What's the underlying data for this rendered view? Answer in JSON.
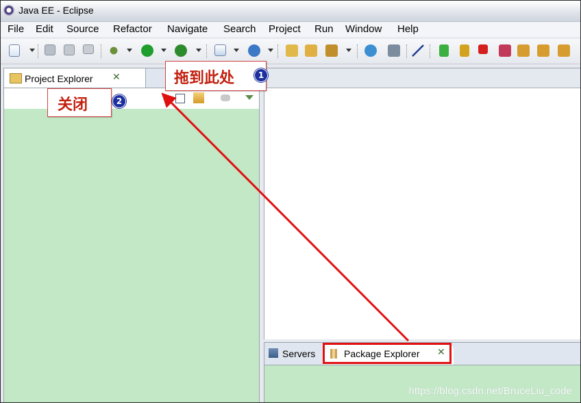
{
  "window": {
    "title": "Java EE - Eclipse"
  },
  "menu": [
    "File",
    "Edit",
    "Source",
    "Refactor",
    "Navigate",
    "Search",
    "Project",
    "Run",
    "Window",
    "Help"
  ],
  "left_view": {
    "tab_label": "Project Explorer"
  },
  "bottom_view": {
    "tabs": [
      "Servers",
      "Package Explorer"
    ]
  },
  "annotations": {
    "callout_drag": "拖到此处",
    "callout_close": "关闭",
    "badge1": "1",
    "badge2": "2"
  },
  "watermark": "https://blog.csdn.net/BruceLiu_code",
  "colors": {
    "view_background": "#c2e8c6",
    "highlight": "#e01010",
    "badge": "#1c2f9e"
  },
  "icons": [
    "eclipse-app-icon",
    "new-wizard-icon",
    "save-icon",
    "save-all-icon",
    "print-icon",
    "debug-icon",
    "run-icon",
    "external-tools-icon",
    "new-server-icon",
    "new-java-class-icon",
    "open-type-icon",
    "search-icon",
    "globe-icon",
    "refactor-icon",
    "skip-breakpoints-icon",
    "resume-icon",
    "suspend-icon",
    "terminate-icon",
    "disconnect-icon",
    "step-into-icon",
    "step-over-icon",
    "step-return-icon"
  ]
}
